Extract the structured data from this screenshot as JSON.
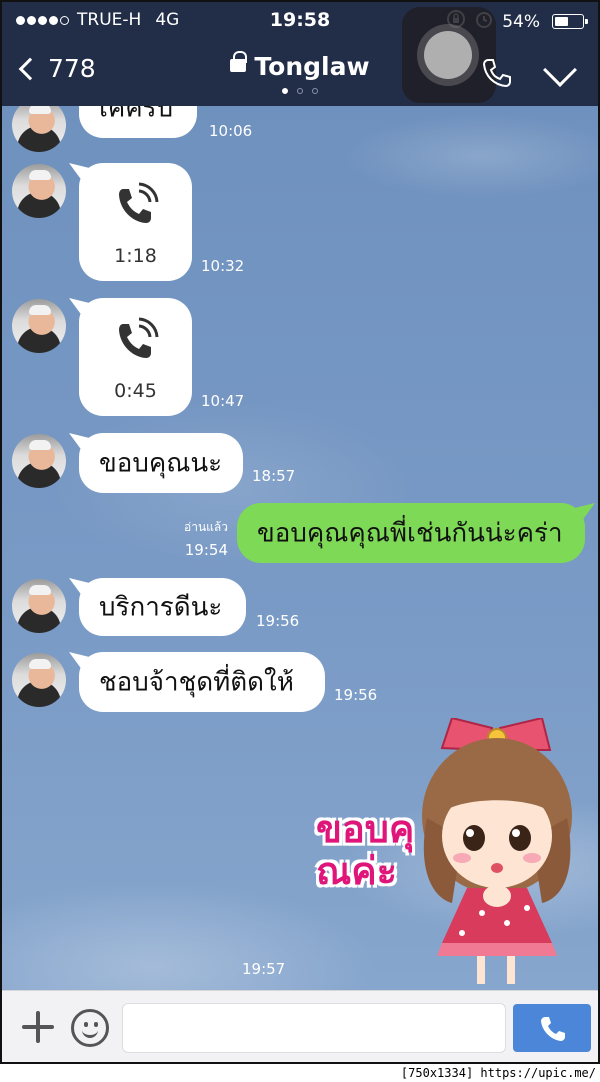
{
  "status_bar": {
    "carrier": "TRUE-H",
    "network": "4G",
    "time": "19:58",
    "battery_percent": "54%",
    "battery_level": 0.54
  },
  "nav": {
    "back_label": "778",
    "title": "Tonglaw"
  },
  "messages": [
    {
      "side": "left",
      "text": "เคครับ",
      "time": "10:06"
    },
    {
      "side": "left",
      "type": "call",
      "duration": "1:18",
      "time": "10:32"
    },
    {
      "side": "left",
      "type": "call",
      "duration": "0:45",
      "time": "10:47"
    },
    {
      "side": "left",
      "text": "ขอบคุณนะ",
      "time": "18:57"
    },
    {
      "side": "right",
      "text": "ขอบคุณคุณพี่เช่นกันน่ะคร่า",
      "read_label": "อ่านแล้ว",
      "time": "19:54"
    },
    {
      "side": "left",
      "text": "บริการดีนะ",
      "time": "19:56"
    },
    {
      "side": "left",
      "text": "ชอบจ้าชุดที่ติดให้",
      "time": "19:56"
    },
    {
      "side": "left",
      "type": "sticker",
      "sticker_text": "ขอบคุณค่ะ",
      "time": "19:57"
    }
  ],
  "input": {
    "placeholder": ""
  },
  "footer_text": "[750x1334] https://upic.me/",
  "colors": {
    "header": "#222d47",
    "chat_bg": "#7a9bc6",
    "my_bubble": "#7ed957",
    "send_button": "#4c86d9"
  }
}
